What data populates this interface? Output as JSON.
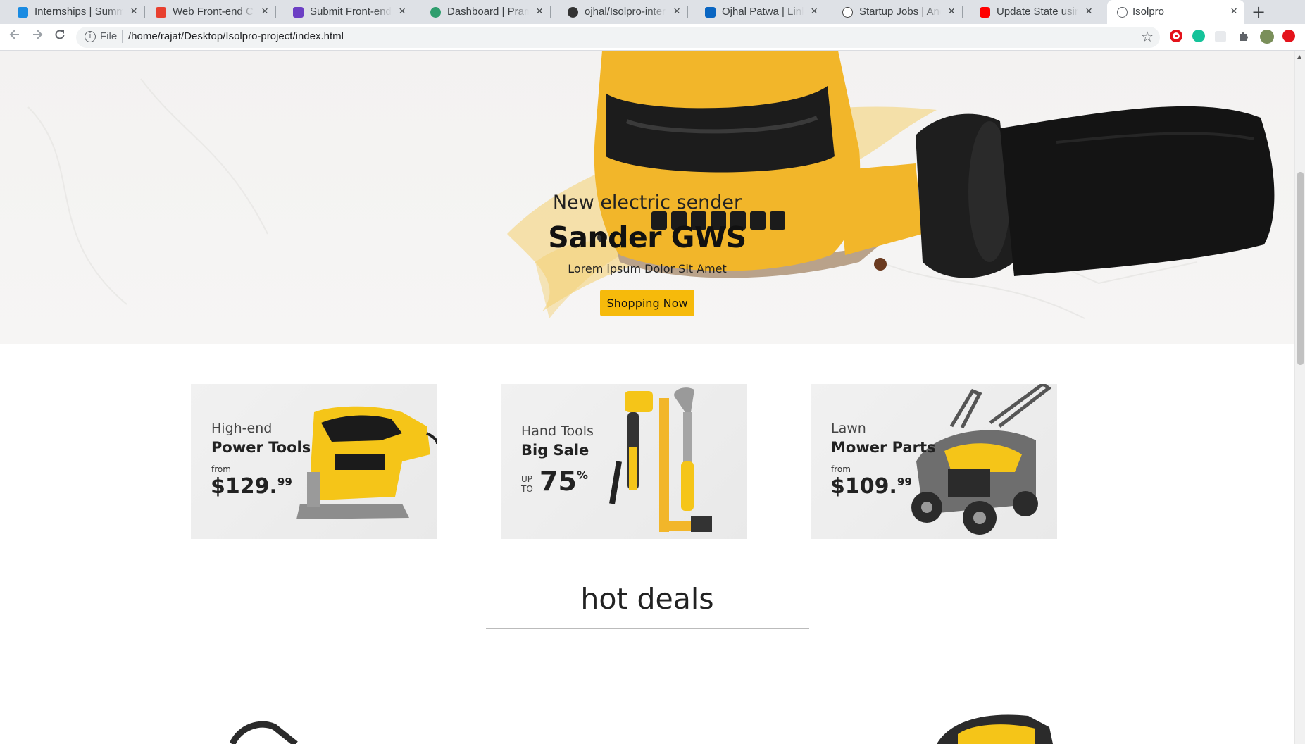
{
  "browser": {
    "tabs": [
      {
        "title": "Internships | Summ",
        "favicon_color": "#1a8be2"
      },
      {
        "title": "Web Front-end Coc",
        "favicon_color": "#e8402f"
      },
      {
        "title": "Submit Front-end C",
        "favicon_color": "#6c3fc4"
      },
      {
        "title": "Dashboard | Pramp",
        "favicon_color": "#2f9e6e"
      },
      {
        "title": "ojhal/Isolpro-interr",
        "favicon_color": "#333333"
      },
      {
        "title": "Ojhal Patwa | Linke",
        "favicon_color": "#0a66c2"
      },
      {
        "title": "Startup Jobs | Ang",
        "favicon_color": "#444444"
      },
      {
        "title": "Update State using",
        "favicon_color": "#ff0000"
      },
      {
        "title": "Isolpro",
        "favicon_color": "#5f6368"
      }
    ],
    "active_tab": 8,
    "close_glyph": "×",
    "new_tab_glyph": "+",
    "address": {
      "scheme_label": "File",
      "url": "/home/rajat/Desktop/Isolpro-project/index.html"
    }
  },
  "hero": {
    "subtitle": "New electric sender",
    "title": "Sander GWS",
    "description": "Lorem ipsum Dolor Sit Amet",
    "button_label": "Shopping Now",
    "accent_color": "#f6ba0b"
  },
  "promos": [
    {
      "light": "High-end",
      "bold": "Power Tools",
      "from": "from",
      "price": "$129.",
      "cents": "99"
    },
    {
      "light": "Hand Tools",
      "bold": "Big Sale",
      "up": "UP",
      "to": "TO",
      "percent": "75",
      "percent_sign": "%"
    },
    {
      "light": "Lawn",
      "bold": "Mower Parts",
      "from": "from",
      "price": "$109.",
      "cents": "99"
    }
  ],
  "sections": {
    "hot_deals_title": "hot deals"
  }
}
